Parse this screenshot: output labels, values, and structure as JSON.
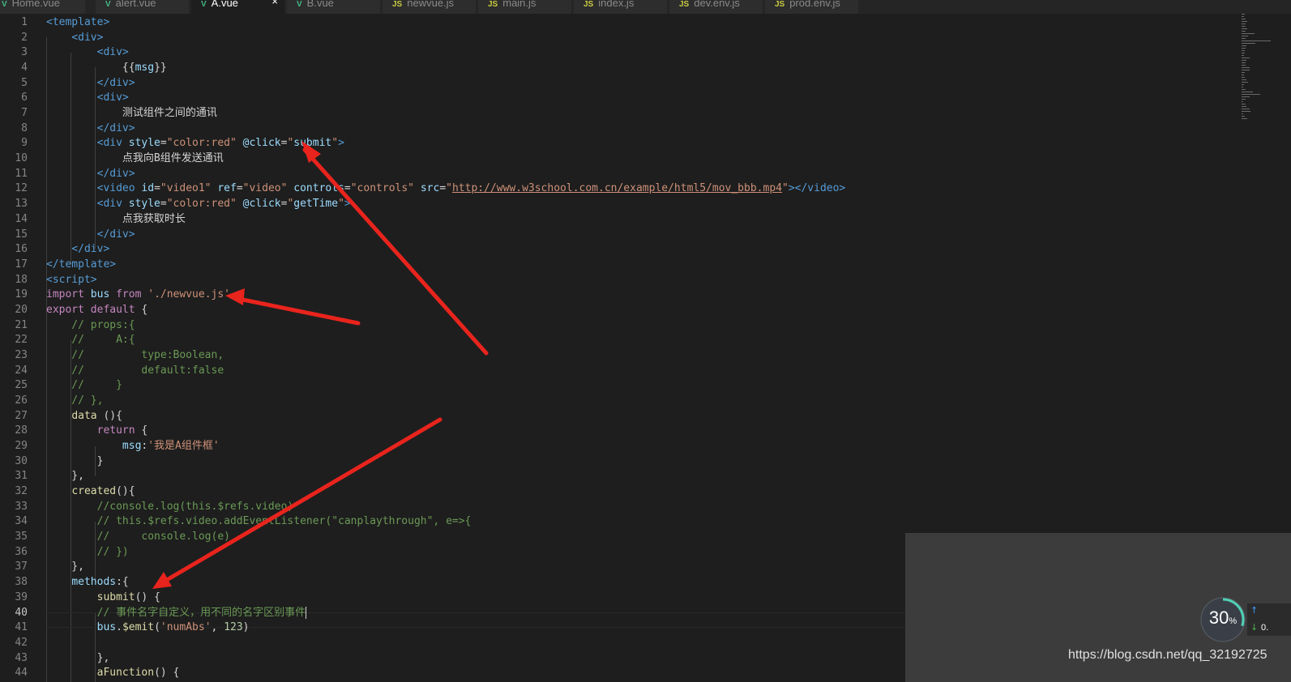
{
  "tabs": [
    {
      "icon": "vue",
      "label": "Home.vue",
      "active": false
    },
    {
      "icon": "vue",
      "label": "alert.vue",
      "active": false
    },
    {
      "icon": "vue",
      "label": "A.vue",
      "active": true,
      "close": "×"
    },
    {
      "icon": "vue",
      "label": "B.vue",
      "active": false
    },
    {
      "icon": "js",
      "label": "newvue.js",
      "active": false
    },
    {
      "icon": "js",
      "label": "main.js",
      "active": false
    },
    {
      "icon": "js",
      "label": "index.js",
      "active": false
    },
    {
      "icon": "js",
      "label": "dev.env.js",
      "active": false
    },
    {
      "icon": "js",
      "label": "prod.env.js",
      "active": false
    }
  ],
  "tab_icon_text": {
    "vue": "V",
    "js": "JS"
  },
  "editor": {
    "current_line": 40,
    "lines": [
      [
        [
          "t-tag",
          "<template>"
        ]
      ],
      [
        [
          "t-tag",
          "    <div>"
        ]
      ],
      [
        [
          "t-tag",
          "        <div>"
        ]
      ],
      [
        [
          "t-plain",
          "            {{"
        ],
        [
          "t-attr",
          "msg"
        ],
        [
          "t-plain",
          "}}"
        ]
      ],
      [
        [
          "t-tag",
          "        </div>"
        ]
      ],
      [
        [
          "t-tag",
          "        <div>"
        ]
      ],
      [
        [
          "t-plain",
          "            测试组件之间的通讯"
        ]
      ],
      [
        [
          "t-tag",
          "        </div>"
        ]
      ],
      [
        [
          "t-tag",
          "        <div "
        ],
        [
          "t-attr",
          "style"
        ],
        [
          "t-plain",
          "="
        ],
        [
          "t-str",
          "\"color:red\""
        ],
        [
          "t-plain",
          " "
        ],
        [
          "t-attr",
          "@click"
        ],
        [
          "t-plain",
          "="
        ],
        [
          "t-str",
          "\""
        ],
        [
          "t-attr",
          "submit"
        ],
        [
          "t-str",
          "\""
        ],
        [
          "t-tag",
          ">"
        ]
      ],
      [
        [
          "t-plain",
          "            点我向B组件发送通讯"
        ]
      ],
      [
        [
          "t-tag",
          "        </div>"
        ]
      ],
      [
        [
          "t-tag",
          "        <video "
        ],
        [
          "t-attr",
          "id"
        ],
        [
          "t-plain",
          "="
        ],
        [
          "t-str",
          "\"video1\""
        ],
        [
          "t-plain",
          " "
        ],
        [
          "t-attr",
          "ref"
        ],
        [
          "t-plain",
          "="
        ],
        [
          "t-str",
          "\"video\""
        ],
        [
          "t-plain",
          " "
        ],
        [
          "t-attr",
          "controls"
        ],
        [
          "t-plain",
          "="
        ],
        [
          "t-str",
          "\"controls\""
        ],
        [
          "t-plain",
          " "
        ],
        [
          "t-attr",
          "src"
        ],
        [
          "t-plain",
          "="
        ],
        [
          "t-str",
          "\""
        ],
        [
          "t-url",
          "http://www.w3school.com.cn/example/html5/mov_bbb.mp4"
        ],
        [
          "t-str",
          "\""
        ],
        [
          "t-tag",
          "></video>"
        ]
      ],
      [
        [
          "t-tag",
          "        <div "
        ],
        [
          "t-attr",
          "style"
        ],
        [
          "t-plain",
          "="
        ],
        [
          "t-str",
          "\"color:red\""
        ],
        [
          "t-plain",
          " "
        ],
        [
          "t-attr",
          "@click"
        ],
        [
          "t-plain",
          "="
        ],
        [
          "t-str",
          "\""
        ],
        [
          "t-attr",
          "getTime"
        ],
        [
          "t-str",
          "\""
        ],
        [
          "t-tag",
          ">"
        ]
      ],
      [
        [
          "t-plain",
          "            点我获取时长"
        ]
      ],
      [
        [
          "t-tag",
          "        </div>"
        ]
      ],
      [
        [
          "t-tag",
          "    </div>"
        ]
      ],
      [
        [
          "t-tag",
          "</template>"
        ]
      ],
      [
        [
          "t-tag",
          "<script>"
        ]
      ],
      [
        [
          "t-kw",
          "import"
        ],
        [
          "t-plain",
          " "
        ],
        [
          "t-attr",
          "bus"
        ],
        [
          "t-plain",
          " "
        ],
        [
          "t-kw",
          "from"
        ],
        [
          "t-plain",
          " "
        ],
        [
          "t-str",
          "'./newvue.js'"
        ]
      ],
      [
        [
          "t-kw",
          "export"
        ],
        [
          "t-plain",
          " "
        ],
        [
          "t-kw",
          "default"
        ],
        [
          "t-plain",
          " {"
        ]
      ],
      [
        [
          "t-cmt",
          "    // props:{"
        ]
      ],
      [
        [
          "t-cmt",
          "    //     A:{"
        ]
      ],
      [
        [
          "t-cmt",
          "    //         type:Boolean,"
        ]
      ],
      [
        [
          "t-cmt",
          "    //         default:false"
        ]
      ],
      [
        [
          "t-cmt",
          "    //     }"
        ]
      ],
      [
        [
          "t-cmt",
          "    // },"
        ]
      ],
      [
        [
          "t-plain",
          "    "
        ],
        [
          "t-fn",
          "data"
        ],
        [
          "t-plain",
          " (){"
        ]
      ],
      [
        [
          "t-plain",
          "        "
        ],
        [
          "t-kw",
          "return"
        ],
        [
          "t-plain",
          " {"
        ]
      ],
      [
        [
          "t-plain",
          "            "
        ],
        [
          "t-attr",
          "msg"
        ],
        [
          "t-plain",
          ":"
        ],
        [
          "t-str",
          "'我是A组件框'"
        ]
      ],
      [
        [
          "t-plain",
          "        }"
        ]
      ],
      [
        [
          "t-plain",
          "    },"
        ]
      ],
      [
        [
          "t-plain",
          "    "
        ],
        [
          "t-fn",
          "created"
        ],
        [
          "t-plain",
          "(){"
        ]
      ],
      [
        [
          "t-cmt",
          "        //console.log(this.$refs.video)"
        ]
      ],
      [
        [
          "t-cmt",
          "        // this.$refs.video.addEventListener(\"canplaythrough\", e=>{"
        ]
      ],
      [
        [
          "t-cmt",
          "        //     console.log(e)"
        ]
      ],
      [
        [
          "t-cmt",
          "        // })"
        ]
      ],
      [
        [
          "t-plain",
          "    },"
        ]
      ],
      [
        [
          "t-plain",
          "    "
        ],
        [
          "t-attr",
          "methods"
        ],
        [
          "t-plain",
          ":{"
        ]
      ],
      [
        [
          "t-plain",
          "        "
        ],
        [
          "t-fn",
          "submit"
        ],
        [
          "t-plain",
          "() {"
        ]
      ],
      [
        [
          "t-cmt",
          "        // 事件名字自定义，用不同的名字区别事件"
        ]
      ],
      [
        [
          "t-plain",
          "        "
        ],
        [
          "t-attr",
          "bus"
        ],
        [
          "t-plain",
          "."
        ],
        [
          "t-fn",
          "$emit"
        ],
        [
          "t-plain",
          "("
        ],
        [
          "t-str",
          "'numAbs'"
        ],
        [
          "t-plain",
          ", "
        ],
        [
          "t-num",
          "123"
        ],
        [
          "t-plain",
          ")"
        ]
      ],
      [
        [
          "t-plain",
          ""
        ]
      ],
      [
        [
          "t-plain",
          "        },"
        ]
      ],
      [
        [
          "t-plain",
          "        "
        ],
        [
          "t-fn",
          "aFunction"
        ],
        [
          "t-plain",
          "() {"
        ]
      ]
    ]
  },
  "speed_widget": {
    "value": "30",
    "unit": "%",
    "progress": 0.3
  },
  "net_panel": {
    "up_icon": "↑",
    "down_icon": "↓",
    "down_value": "0."
  },
  "watermark": "https://blog.csdn.net/qq_32192725",
  "colors": {
    "arrow": "#e8241d",
    "editor_bg": "#1e1e1e"
  }
}
